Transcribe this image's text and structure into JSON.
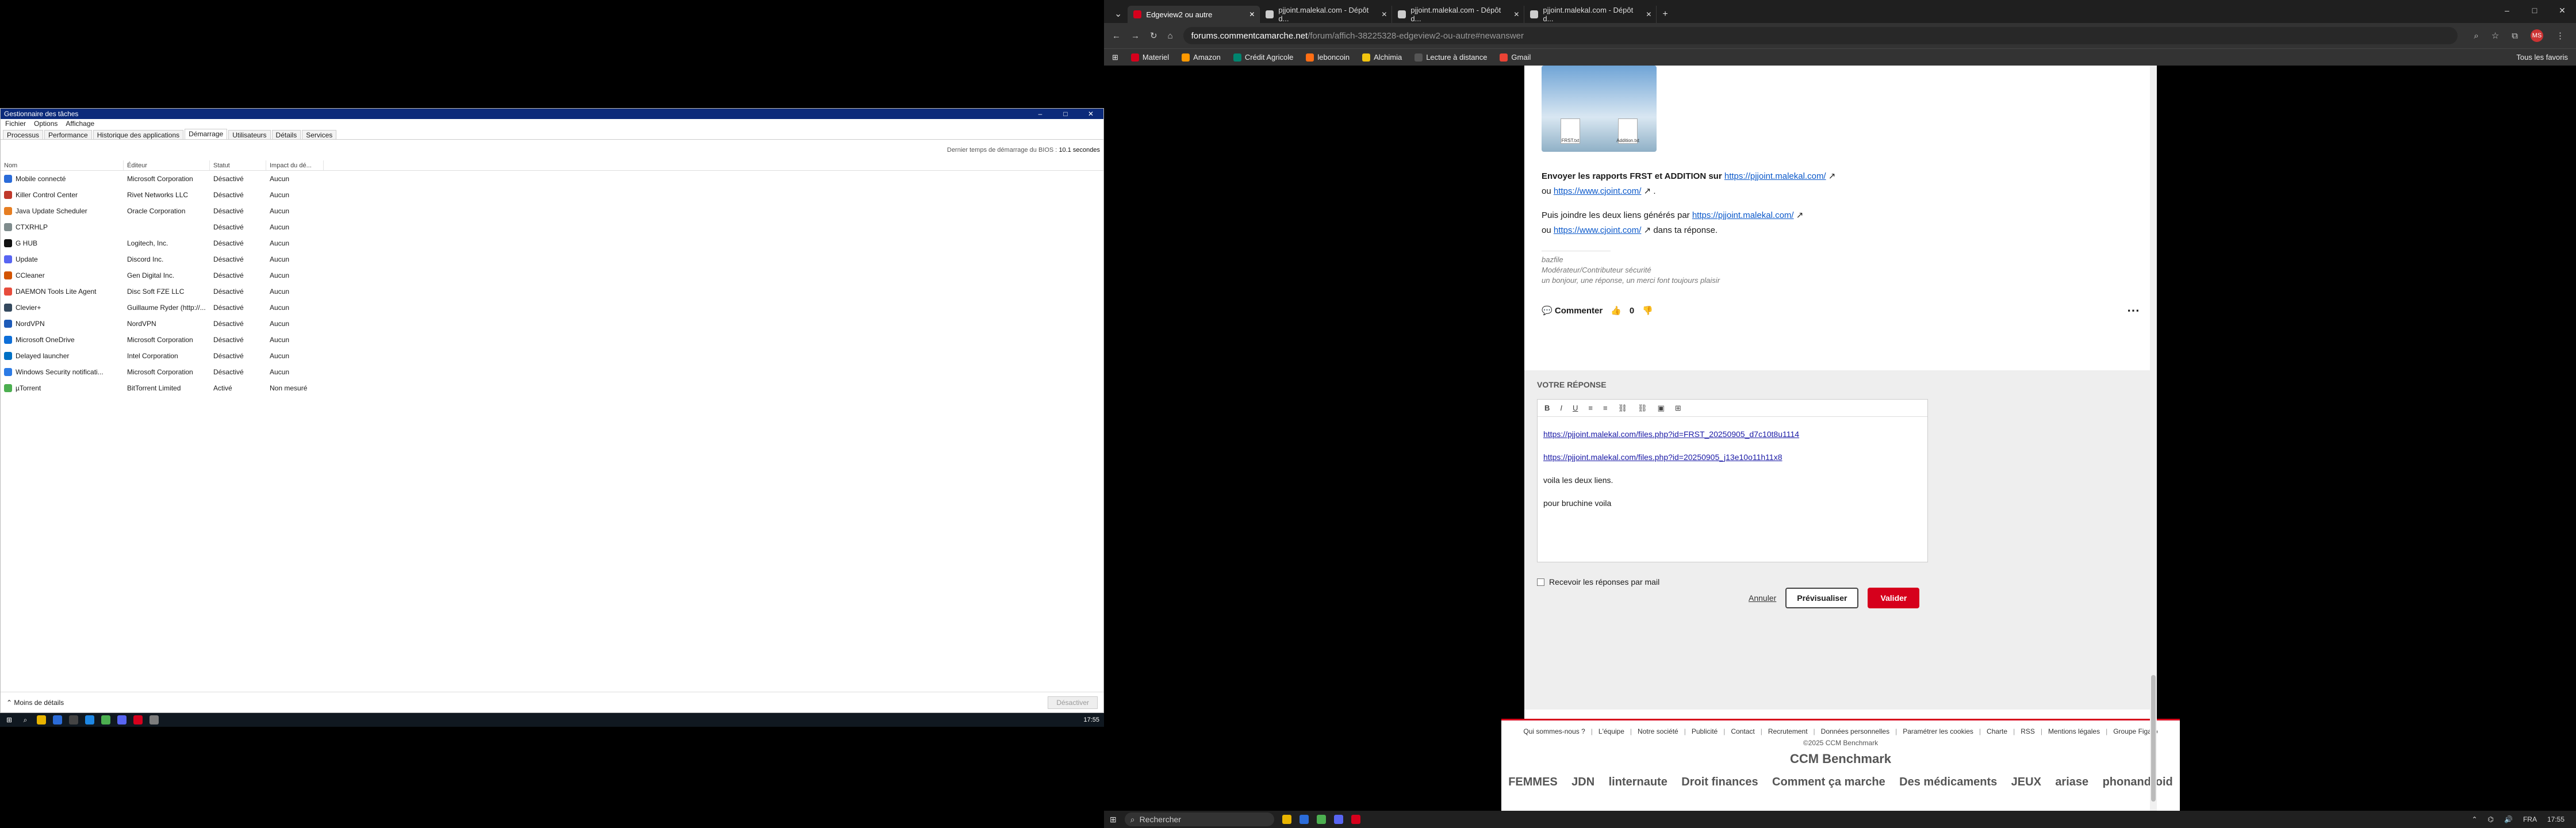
{
  "taskmgr": {
    "title": "Gestionnaire des tâches",
    "menu": [
      "Fichier",
      "Options",
      "Affichage"
    ],
    "tabs": [
      "Processus",
      "Performance",
      "Historique des applications",
      "Démarrage",
      "Utilisateurs",
      "Détails",
      "Services"
    ],
    "bios_label": "Dernier temps de démarrage du BIOS :",
    "bios_value": "10.1 secondes",
    "columns": [
      "Nom",
      "Éditeur",
      "Statut",
      "Impact du dé..."
    ],
    "rows": [
      {
        "name": "Mobile connecté",
        "publisher": "Microsoft Corporation",
        "status": "Désactivé",
        "impact": "Aucun",
        "color": "#2b6cd9"
      },
      {
        "name": "Killer Control Center",
        "publisher": "Rivet Networks LLC",
        "status": "Désactivé",
        "impact": "Aucun",
        "color": "#c0392b"
      },
      {
        "name": "Java Update Scheduler",
        "publisher": "Oracle Corporation",
        "status": "Désactivé",
        "impact": "Aucun",
        "color": "#e67e22"
      },
      {
        "name": "CTXRHLP",
        "publisher": "",
        "status": "Désactivé",
        "impact": "Aucun",
        "color": "#7f8c8d"
      },
      {
        "name": "G HUB",
        "publisher": "Logitech, Inc.",
        "status": "Désactivé",
        "impact": "Aucun",
        "color": "#111111"
      },
      {
        "name": "Update",
        "publisher": "Discord Inc.",
        "status": "Désactivé",
        "impact": "Aucun",
        "color": "#5865f2"
      },
      {
        "name": "CCleaner",
        "publisher": "Gen Digital Inc.",
        "status": "Désactivé",
        "impact": "Aucun",
        "color": "#d35400"
      },
      {
        "name": "DAEMON Tools Lite Agent",
        "publisher": "Disc Soft FZE LLC",
        "status": "Désactivé",
        "impact": "Aucun",
        "color": "#e74c3c"
      },
      {
        "name": "Clevier+",
        "publisher": "Guillaume Ryder (http://...",
        "status": "Désactivé",
        "impact": "Aucun",
        "color": "#34495e"
      },
      {
        "name": "NordVPN",
        "publisher": "NordVPN",
        "status": "Désactivé",
        "impact": "Aucun",
        "color": "#1e5bb8"
      },
      {
        "name": "Microsoft OneDrive",
        "publisher": "Microsoft Corporation",
        "status": "Désactivé",
        "impact": "Aucun",
        "color": "#0e6fd8"
      },
      {
        "name": "Delayed launcher",
        "publisher": "Intel Corporation",
        "status": "Désactivé",
        "impact": "Aucun",
        "color": "#0071c5"
      },
      {
        "name": "Windows Security notificati...",
        "publisher": "Microsoft Corporation",
        "status": "Désactivé",
        "impact": "Aucun",
        "color": "#2c7be5"
      },
      {
        "name": "µTorrent",
        "publisher": "BitTorrent Limited",
        "status": "Activé",
        "impact": "Non mesuré",
        "color": "#4caf50"
      }
    ],
    "less_details": "Moins de détails",
    "disable_button": "Désactiver"
  },
  "left_taskbar": {
    "clock": "17:55"
  },
  "browser": {
    "tabs": [
      {
        "title": "Edgeview2 ou autre",
        "color": "#d6001c"
      },
      {
        "title": "pjjoint.malekal.com - Dépôt d...",
        "color": "#cccccc"
      },
      {
        "title": "pjjoint.malekal.com - Dépôt d...",
        "color": "#cccccc"
      },
      {
        "title": "pjjoint.malekal.com - Dépôt d...",
        "color": "#cccccc"
      }
    ],
    "new_tab": "+",
    "url_host": "forums.commentcamarche.net",
    "url_path": "/forum/affich-38225328-edgeview2-ou-autre#newanswer",
    "bookmarks": [
      {
        "label": "Materiel",
        "color": "#d6001c"
      },
      {
        "label": "Amazon",
        "color": "#ff9900"
      },
      {
        "label": "Crédit Agricole",
        "color": "#00856f"
      },
      {
        "label": "leboncoin",
        "color": "#ff6e14"
      },
      {
        "label": "Alchimia",
        "color": "#f1c40f"
      },
      {
        "label": "Lecture à distance",
        "color": "#555555"
      },
      {
        "label": "Gmail",
        "color": "#ea4335"
      }
    ],
    "bookmarks_far": "Tous les favoris",
    "profile": "MS"
  },
  "post": {
    "thumb_files": [
      "FRST.txt",
      "Addition.txt"
    ],
    "send_prefix": "Envoyer les rapports FRST et ADDITION sur",
    "link_pjjoint": "https://pjjoint.malekal.com/",
    "or": "ou",
    "link_cjoint": "https://www.cjoint.com/",
    "then_prefix": "Puis joindre les deux liens générés par",
    "in_reply": "dans ta réponse.",
    "sig_name": "bazfile",
    "sig_role": "Modérateur/Contributeur sécurité",
    "sig_quote": "un bonjour, une réponse, un merci font toujours plaisir",
    "comment": "Commenter",
    "likes": "0"
  },
  "reply": {
    "heading": "Votre réponse",
    "toolbar": [
      "B",
      "I",
      "U",
      "≡",
      "≡",
      "⛓",
      "⛓",
      "▣",
      "⊞"
    ],
    "link1": "https://pjjoint.malekal.com/files.php?id=FRST_20250905_d7c10t8u1114",
    "link2": "https://pjjoint.malekal.com/files.php?id=20250905_j13e10o11h11x8",
    "line3": "voila les deux liens.",
    "line4": "pour bruchine voila",
    "notify": "Recevoir les réponses par mail",
    "cancel": "Annuler",
    "preview": "Prévisualiser",
    "submit": "Valider"
  },
  "footer": {
    "links": [
      "Qui sommes-nous ?",
      "L'équipe",
      "Notre société",
      "Publicité",
      "Contact",
      "Recrutement",
      "Données personnelles",
      "Paramétrer les cookies",
      "Charte",
      "RSS",
      "Mentions légales",
      "Groupe Figaro"
    ],
    "copyright": "©2025 CCM Benchmark",
    "logo": "CCM Benchmark",
    "brands": [
      "FEMMES",
      "JDN",
      "linternaute",
      "Droit finances",
      "Comment ça marche",
      "Des médicaments",
      "JEUX",
      "ariase",
      "phonandroid"
    ]
  },
  "right_taskbar": {
    "search": "Rechercher",
    "lang": "FRA",
    "time": "17:55"
  }
}
